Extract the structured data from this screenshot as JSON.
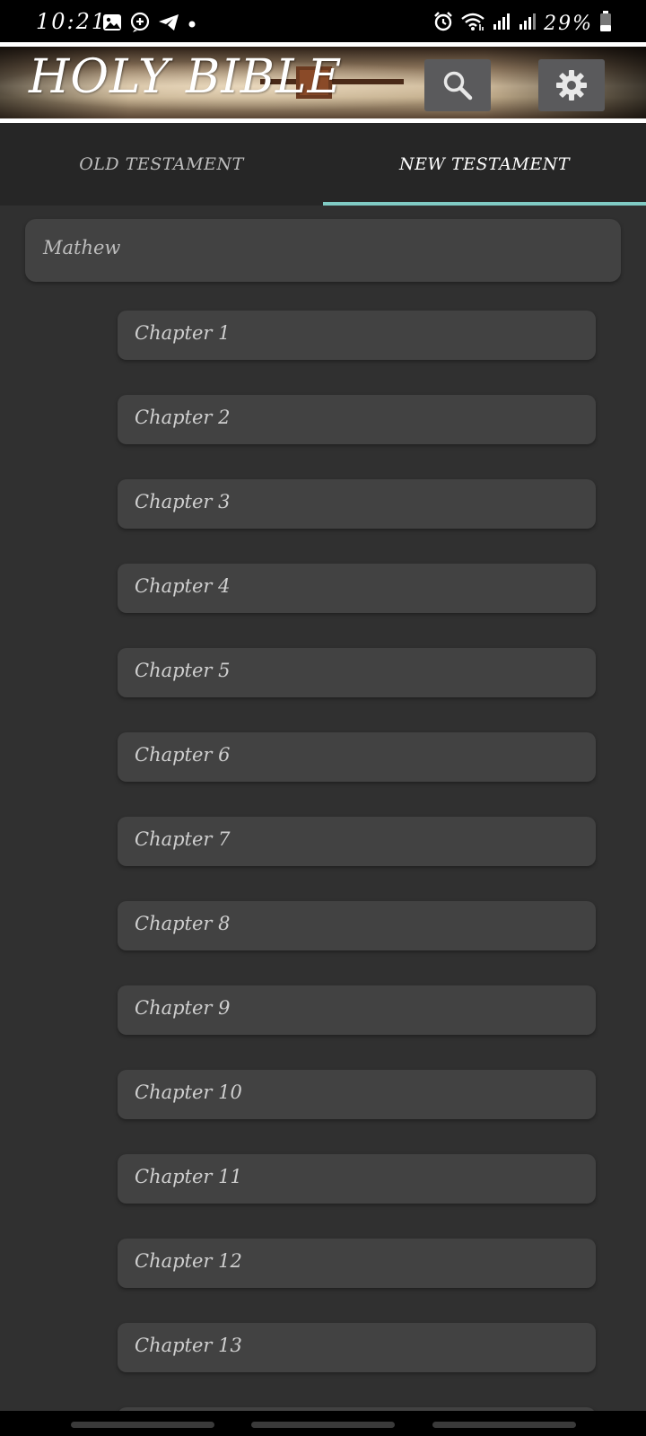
{
  "status_bar": {
    "time": "10:21",
    "battery": "29%",
    "left_icons": [
      "gallery-icon",
      "plus-circle-icon",
      "telegram-icon",
      "dot-icon"
    ],
    "right_icons": [
      "alarm-icon",
      "wifi-icon",
      "signal-icon",
      "signal-icon",
      "battery-icon"
    ]
  },
  "header": {
    "title": "HOLY BIBLE",
    "search_icon": "search-icon",
    "settings_icon": "gear-icon"
  },
  "tabs": [
    {
      "label": "OLD TESTAMENT",
      "selected": false
    },
    {
      "label": "NEW TESTAMENT",
      "selected": true
    }
  ],
  "book": {
    "label": "Mathew"
  },
  "chapters": [
    {
      "label": "Chapter 1"
    },
    {
      "label": "Chapter 2"
    },
    {
      "label": "Chapter 3"
    },
    {
      "label": "Chapter 4"
    },
    {
      "label": "Chapter 5"
    },
    {
      "label": "Chapter 6"
    },
    {
      "label": "Chapter 7"
    },
    {
      "label": "Chapter 8"
    },
    {
      "label": "Chapter 9"
    },
    {
      "label": "Chapter 10"
    },
    {
      "label": "Chapter 11"
    },
    {
      "label": "Chapter 12"
    },
    {
      "label": "Chapter 13"
    }
  ],
  "colors": {
    "background": "#303030",
    "tab_bar": "#262626",
    "item": "#424242",
    "tab_indicator": "#80cbc4",
    "icon_button": "#5a5a5c"
  }
}
